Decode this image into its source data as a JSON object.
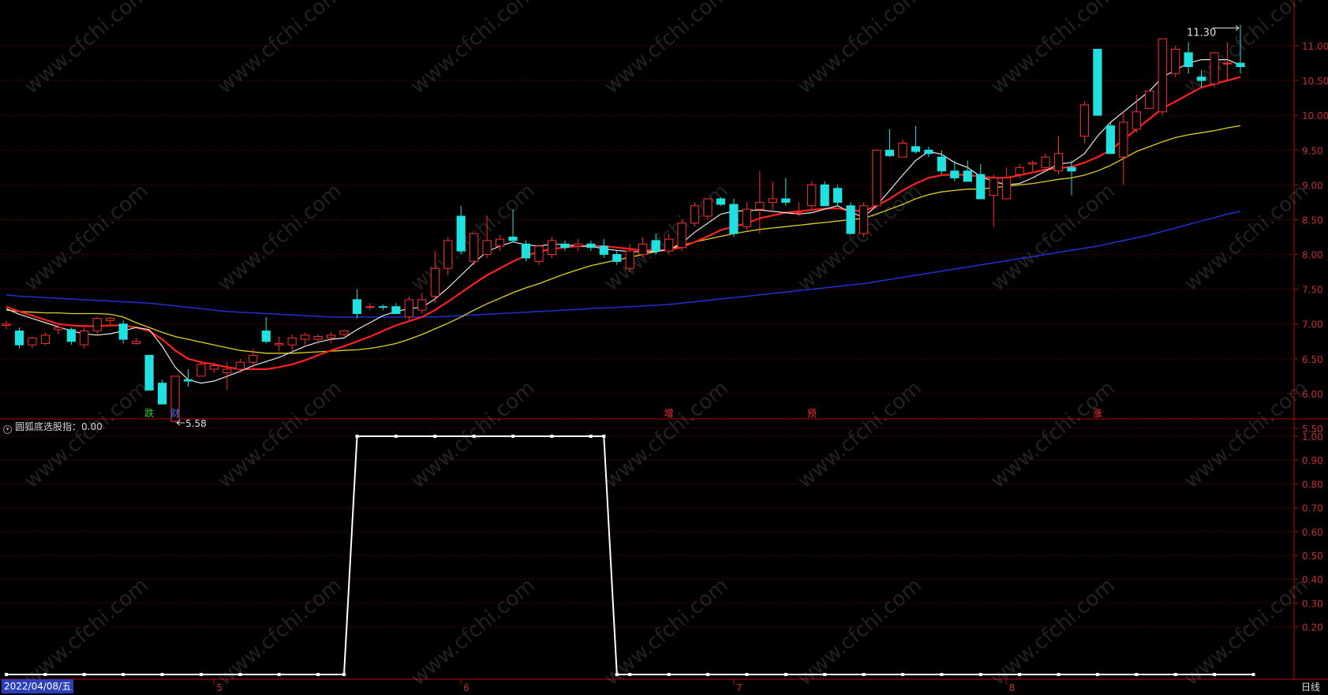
{
  "colors": {
    "up": "#ff3030",
    "down": "#20e0e0",
    "grid": "#5a0000",
    "axis": "#c00000",
    "ma5": "#e8e8e8",
    "ma10": "#ff2020",
    "ma20": "#e0d020",
    "ma60": "#2030d0",
    "indicator": "#ffffff",
    "tick_text": "#c03030"
  },
  "chart_data": [
    {
      "type": "candlestick",
      "ylim": [
        5.4,
        11.4
      ],
      "y_ticks": [
        "5.50",
        "6.00",
        "6.50",
        "7.00",
        "7.50",
        "8.00",
        "8.50",
        "9.00",
        "9.50",
        "10.00",
        "10.50",
        "11.00"
      ],
      "ohlc": [
        [
          6.98,
          7.05,
          6.92,
          7.0
        ],
        [
          6.9,
          6.95,
          6.65,
          6.7
        ],
        [
          6.7,
          6.82,
          6.65,
          6.8
        ],
        [
          6.72,
          6.88,
          6.7,
          6.84
        ],
        [
          6.92,
          6.98,
          6.85,
          6.95
        ],
        [
          6.92,
          6.95,
          6.7,
          6.75
        ],
        [
          6.7,
          6.95,
          6.65,
          6.9
        ],
        [
          6.9,
          7.1,
          6.85,
          7.08
        ],
        [
          7.05,
          7.1,
          7.0,
          7.08
        ],
        [
          7.0,
          7.05,
          6.72,
          6.78
        ],
        [
          6.72,
          6.8,
          6.7,
          6.75
        ],
        [
          6.55,
          6.55,
          6.05,
          6.05
        ],
        [
          6.15,
          6.2,
          5.85,
          5.85
        ],
        [
          5.6,
          6.25,
          5.58,
          6.25
        ],
        [
          6.2,
          6.35,
          6.1,
          6.18
        ],
        [
          6.25,
          6.45,
          6.25,
          6.42
        ],
        [
          6.35,
          6.45,
          6.3,
          6.4
        ],
        [
          6.3,
          6.45,
          6.05,
          6.35
        ],
        [
          6.35,
          6.5,
          6.3,
          6.45
        ],
        [
          6.45,
          6.65,
          6.35,
          6.55
        ],
        [
          6.9,
          7.1,
          6.72,
          6.75
        ],
        [
          6.7,
          6.82,
          6.6,
          6.72
        ],
        [
          6.7,
          6.85,
          6.6,
          6.8
        ],
        [
          6.78,
          6.88,
          6.7,
          6.84
        ],
        [
          6.78,
          6.85,
          6.72,
          6.82
        ],
        [
          6.8,
          6.88,
          6.72,
          6.84
        ],
        [
          6.85,
          6.92,
          6.82,
          6.9
        ],
        [
          7.35,
          7.5,
          7.08,
          7.15
        ],
        [
          7.25,
          7.3,
          7.2,
          7.25
        ],
        [
          7.25,
          7.28,
          7.2,
          7.24
        ],
        [
          7.25,
          7.3,
          7.15,
          7.15
        ],
        [
          7.1,
          7.4,
          7.05,
          7.35
        ],
        [
          7.2,
          7.45,
          7.15,
          7.35
        ],
        [
          7.4,
          8.05,
          7.3,
          7.8
        ],
        [
          7.8,
          8.25,
          7.7,
          8.2
        ],
        [
          8.55,
          8.7,
          8.0,
          8.05
        ],
        [
          7.9,
          8.3,
          7.85,
          8.3
        ],
        [
          8.0,
          8.55,
          7.95,
          8.2
        ],
        [
          8.12,
          8.28,
          8.05,
          8.22
        ],
        [
          8.25,
          8.65,
          8.18,
          8.2
        ],
        [
          8.15,
          8.2,
          7.9,
          7.95
        ],
        [
          7.9,
          8.15,
          7.85,
          8.12
        ],
        [
          8.0,
          8.25,
          7.95,
          8.2
        ],
        [
          8.15,
          8.2,
          8.05,
          8.1
        ],
        [
          8.12,
          8.22,
          8.05,
          8.15
        ],
        [
          8.15,
          8.2,
          8.05,
          8.1
        ],
        [
          8.12,
          8.22,
          7.95,
          8.0
        ],
        [
          8.0,
          8.05,
          7.85,
          7.9
        ],
        [
          7.8,
          8.15,
          7.75,
          8.05
        ],
        [
          8.0,
          8.25,
          7.95,
          8.15
        ],
        [
          8.2,
          8.3,
          8.0,
          8.05
        ],
        [
          8.05,
          8.3,
          8.0,
          8.22
        ],
        [
          8.1,
          8.5,
          8.05,
          8.45
        ],
        [
          8.45,
          8.75,
          8.4,
          8.7
        ],
        [
          8.55,
          8.8,
          8.5,
          8.8
        ],
        [
          8.8,
          8.82,
          8.7,
          8.72
        ],
        [
          8.72,
          8.8,
          8.25,
          8.3
        ],
        [
          8.4,
          8.75,
          8.35,
          8.65
        ],
        [
          8.65,
          9.2,
          8.3,
          8.75
        ],
        [
          8.75,
          9.05,
          8.6,
          8.8
        ],
        [
          8.8,
          9.1,
          8.7,
          8.75
        ],
        [
          8.6,
          8.75,
          8.55,
          8.6
        ],
        [
          8.7,
          9.05,
          8.65,
          9.0
        ],
        [
          9.0,
          9.05,
          8.7,
          8.7
        ],
        [
          8.95,
          9.0,
          8.7,
          8.75
        ],
        [
          8.7,
          8.75,
          8.3,
          8.3
        ],
        [
          8.3,
          8.75,
          8.25,
          8.7
        ],
        [
          8.7,
          9.5,
          8.65,
          9.5
        ],
        [
          9.5,
          9.8,
          9.4,
          9.42
        ],
        [
          9.4,
          9.65,
          9.4,
          9.6
        ],
        [
          9.55,
          9.85,
          9.45,
          9.48
        ],
        [
          9.5,
          9.55,
          9.4,
          9.45
        ],
        [
          9.4,
          9.5,
          9.15,
          9.2
        ],
        [
          9.2,
          9.35,
          9.05,
          9.1
        ],
        [
          9.2,
          9.35,
          9.05,
          9.05
        ],
        [
          9.15,
          9.3,
          8.8,
          8.8
        ],
        [
          8.85,
          9.15,
          8.4,
          9.1
        ],
        [
          8.8,
          9.25,
          8.8,
          9.1
        ],
        [
          9.15,
          9.3,
          9.1,
          9.25
        ],
        [
          9.3,
          9.35,
          9.2,
          9.32
        ],
        [
          9.25,
          9.45,
          9.2,
          9.4
        ],
        [
          9.2,
          9.7,
          9.15,
          9.45
        ],
        [
          9.25,
          9.35,
          8.85,
          9.2
        ],
        [
          9.7,
          10.2,
          9.6,
          10.15
        ],
        [
          10.95,
          10.95,
          10.0,
          10.0
        ],
        [
          9.85,
          9.9,
          9.5,
          9.45
        ],
        [
          9.4,
          10.05,
          9.0,
          9.9
        ],
        [
          9.8,
          10.3,
          9.75,
          10.05
        ],
        [
          10.1,
          10.35,
          10.1,
          10.35
        ],
        [
          10.05,
          11.1,
          10.0,
          11.1
        ],
        [
          10.6,
          11.0,
          10.55,
          10.95
        ],
        [
          10.9,
          11.05,
          10.6,
          10.7
        ],
        [
          10.55,
          10.65,
          10.4,
          10.5
        ],
        [
          10.45,
          10.9,
          10.4,
          10.9
        ],
        [
          10.75,
          11.05,
          10.5,
          10.75
        ],
        [
          10.75,
          11.3,
          10.6,
          10.7
        ]
      ],
      "ma5": [
        7.22,
        7.14,
        7.08,
        7.02,
        6.96,
        6.9,
        6.86,
        6.84,
        6.86,
        6.9,
        6.95,
        6.92,
        6.68,
        6.38,
        6.2,
        6.15,
        6.18,
        6.25,
        6.32,
        6.4,
        6.46,
        6.52,
        6.6,
        6.68,
        6.74,
        6.78,
        6.8,
        6.92,
        7.02,
        7.12,
        7.18,
        7.22,
        7.24,
        7.36,
        7.52,
        7.7,
        7.88,
        8.04,
        8.12,
        8.18,
        8.14,
        8.12,
        8.15,
        8.14,
        8.12,
        8.12,
        8.08,
        8.06,
        8.04,
        8.04,
        8.04,
        8.07,
        8.16,
        8.32,
        8.45,
        8.58,
        8.62,
        8.63,
        8.64,
        8.62,
        8.6,
        8.58,
        8.6,
        8.65,
        8.7,
        8.6,
        8.54,
        8.7,
        8.92,
        9.14,
        9.35,
        9.48,
        9.44,
        9.32,
        9.25,
        9.12,
        9.05,
        9.0,
        9.02,
        9.1,
        9.2,
        9.3,
        9.32,
        9.45,
        9.7,
        9.9,
        10.05,
        10.2,
        10.35,
        10.55,
        10.65,
        10.75,
        10.8,
        10.8,
        10.8,
        10.72
      ],
      "ma10": [
        7.25,
        7.18,
        7.12,
        7.06,
        7.0,
        6.98,
        6.97,
        6.97,
        6.98,
        6.98,
        6.95,
        6.9,
        6.78,
        6.62,
        6.5,
        6.45,
        6.42,
        6.38,
        6.35,
        6.35,
        6.35,
        6.38,
        6.42,
        6.48,
        6.55,
        6.62,
        6.68,
        6.75,
        6.82,
        6.9,
        6.98,
        7.04,
        7.1,
        7.2,
        7.32,
        7.45,
        7.58,
        7.7,
        7.8,
        7.9,
        7.98,
        8.04,
        8.08,
        8.1,
        8.12,
        8.12,
        8.12,
        8.1,
        8.08,
        8.06,
        8.06,
        8.07,
        8.1,
        8.18,
        8.26,
        8.35,
        8.4,
        8.45,
        8.52,
        8.56,
        8.6,
        8.62,
        8.64,
        8.66,
        8.66,
        8.64,
        8.62,
        8.7,
        8.8,
        8.92,
        9.02,
        9.1,
        9.14,
        9.15,
        9.14,
        9.12,
        9.1,
        9.1,
        9.14,
        9.18,
        9.22,
        9.24,
        9.26,
        9.32,
        9.4,
        9.5,
        9.65,
        9.8,
        9.95,
        10.1,
        10.2,
        10.3,
        10.4,
        10.45,
        10.5,
        10.55
      ],
      "ma20": [
        7.2,
        7.18,
        7.17,
        7.16,
        7.16,
        7.15,
        7.15,
        7.15,
        7.14,
        7.1,
        7.02,
        6.95,
        6.88,
        6.82,
        6.78,
        6.74,
        6.7,
        6.66,
        6.62,
        6.6,
        6.58,
        6.58,
        6.58,
        6.59,
        6.6,
        6.61,
        6.62,
        6.63,
        6.65,
        6.68,
        6.72,
        6.78,
        6.85,
        6.93,
        7.01,
        7.1,
        7.2,
        7.29,
        7.37,
        7.45,
        7.52,
        7.58,
        7.65,
        7.72,
        7.78,
        7.84,
        7.88,
        7.92,
        7.96,
        8.0,
        8.04,
        8.08,
        8.13,
        8.18,
        8.22,
        8.26,
        8.3,
        8.33,
        8.36,
        8.38,
        8.4,
        8.42,
        8.44,
        8.46,
        8.48,
        8.5,
        8.52,
        8.58,
        8.65,
        8.72,
        8.8,
        8.86,
        8.9,
        8.92,
        8.94,
        8.94,
        8.96,
        8.98,
        9.0,
        9.02,
        9.05,
        9.08,
        9.1,
        9.14,
        9.2,
        9.28,
        9.38,
        9.48,
        9.55,
        9.62,
        9.68,
        9.72,
        9.75,
        9.78,
        9.82,
        9.85
      ],
      "ma60": [
        7.42,
        7.4,
        7.39,
        7.38,
        7.37,
        7.36,
        7.35,
        7.34,
        7.33,
        7.32,
        7.31,
        7.3,
        7.28,
        7.26,
        7.24,
        7.22,
        7.2,
        7.18,
        7.17,
        7.16,
        7.15,
        7.14,
        7.13,
        7.12,
        7.11,
        7.1,
        7.1,
        7.1,
        7.1,
        7.1,
        7.1,
        7.1,
        7.1,
        7.1,
        7.11,
        7.12,
        7.13,
        7.14,
        7.15,
        7.16,
        7.17,
        7.18,
        7.19,
        7.2,
        7.21,
        7.22,
        7.23,
        7.24,
        7.25,
        7.26,
        7.27,
        7.28,
        7.3,
        7.32,
        7.34,
        7.36,
        7.38,
        7.4,
        7.42,
        7.44,
        7.46,
        7.48,
        7.5,
        7.52,
        7.54,
        7.56,
        7.58,
        7.61,
        7.64,
        7.67,
        7.7,
        7.73,
        7.76,
        7.79,
        7.82,
        7.85,
        7.88,
        7.91,
        7.94,
        7.97,
        8.0,
        8.03,
        8.06,
        8.09,
        8.12,
        8.16,
        8.2,
        8.24,
        8.28,
        8.33,
        8.38,
        8.43,
        8.48,
        8.53,
        8.58,
        8.62
      ],
      "annotations": {
        "high_label": "11.30",
        "low_label": "5.58"
      },
      "event_markers": [
        {
          "index": 11,
          "text": "跌",
          "color": "#30d030"
        },
        {
          "index": 13,
          "text": "财",
          "color": "#4080ff"
        },
        {
          "index": 51,
          "text": "增",
          "color": "#ff3030"
        },
        {
          "index": 62,
          "text": "预",
          "color": "#ff3030"
        },
        {
          "index": 84,
          "text": "涨",
          "color": "#ff3030"
        }
      ]
    },
    {
      "type": "line",
      "title": "圆狐底选股指：0.00",
      "ylim": [
        0,
        1.05
      ],
      "y_ticks": [
        "0.20",
        "0.30",
        "0.40",
        "0.50",
        "0.60",
        "0.70",
        "0.80",
        "0.90",
        "1.00"
      ],
      "x": [
        0,
        3,
        6,
        9,
        12,
        15,
        18,
        21,
        24,
        26,
        27,
        30,
        33,
        36,
        39,
        42,
        45,
        46,
        47,
        48,
        51,
        54,
        57,
        60,
        63,
        66,
        69,
        72,
        75,
        78,
        81,
        84,
        87,
        90,
        93,
        96
      ],
      "values": [
        0,
        0,
        0,
        0,
        0,
        0,
        0,
        0,
        0,
        0,
        1,
        1,
        1,
        1,
        1,
        1,
        1,
        1,
        0,
        0,
        0,
        0,
        0,
        0,
        0,
        0,
        0,
        0,
        0,
        0,
        0,
        0,
        0,
        0,
        0,
        0
      ]
    }
  ],
  "x_axis": {
    "labels": [
      {
        "index": 16,
        "text": "5"
      },
      {
        "index": 35,
        "text": "6"
      },
      {
        "index": 56,
        "text": "7"
      },
      {
        "index": 77,
        "text": "8"
      }
    ]
  },
  "footer": {
    "date": "2022/04/08/五",
    "period": "日线"
  },
  "watermark": "www.cfchi.com"
}
